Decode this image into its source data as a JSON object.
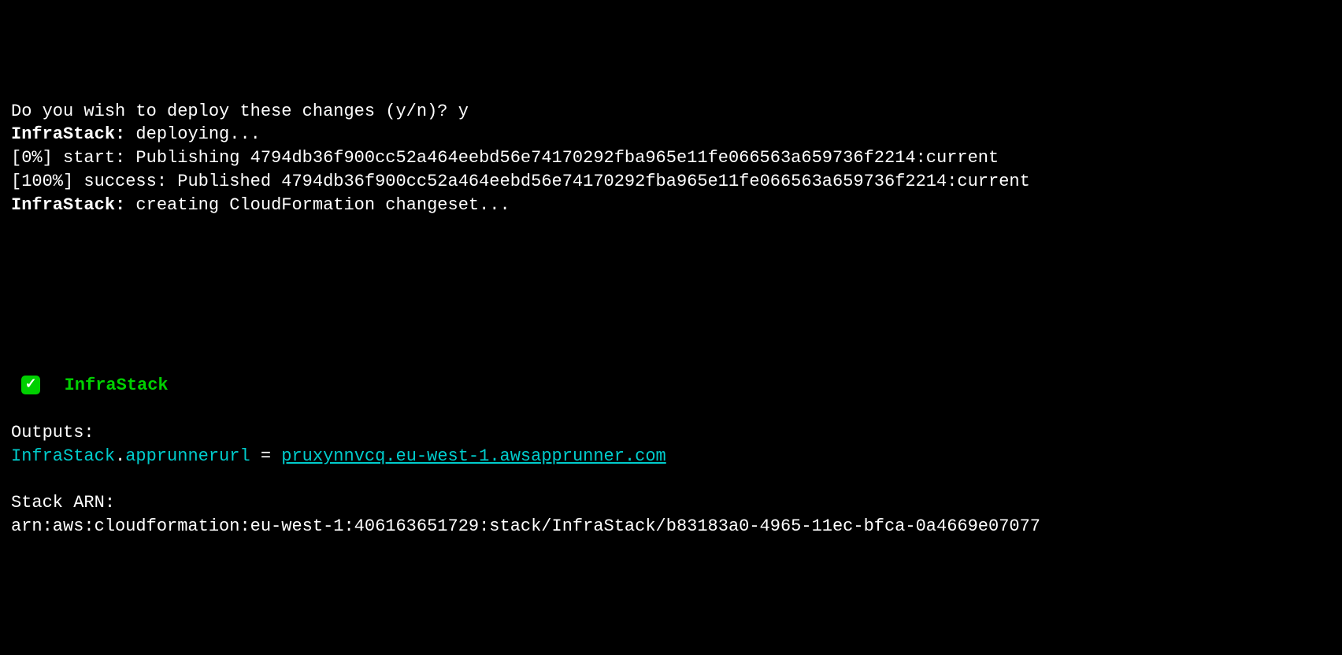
{
  "prompt": {
    "question": "Do you wish to deploy these changes (y/n)? ",
    "answer": "y"
  },
  "deploy": {
    "stack_name": "InfraStack:",
    "action": " deploying..."
  },
  "publish_start": {
    "percent": "[0%]",
    "label": " start: Publishing ",
    "hash": "4794db36f900cc52a464eebd56e74170292fba965e11fe066563a659736f2214:current"
  },
  "publish_done": {
    "percent": "[100%]",
    "label": " success: Published ",
    "hash": "4794db36f900cc52a464eebd56e74170292fba965e11fe066563a659736f2214:current"
  },
  "changeset": {
    "stack_name": "InfraStack:",
    "action": " creating CloudFormation changeset..."
  },
  "success": {
    "stack_name": "InfraStack"
  },
  "outputs": {
    "header": "Outputs:",
    "key_stack": "InfraStack",
    "key_dot": ".",
    "key_attr": "apprunnerurl",
    "equals": " = ",
    "url": "pruxynnvcq.eu-west-1.awsapprunner.com"
  },
  "stack_arn": {
    "header": "Stack ARN:",
    "value": "arn:aws:cloudformation:eu-west-1:406163651729:stack/InfraStack/b83183a0-4965-11ec-bfca-0a4669e07077"
  }
}
